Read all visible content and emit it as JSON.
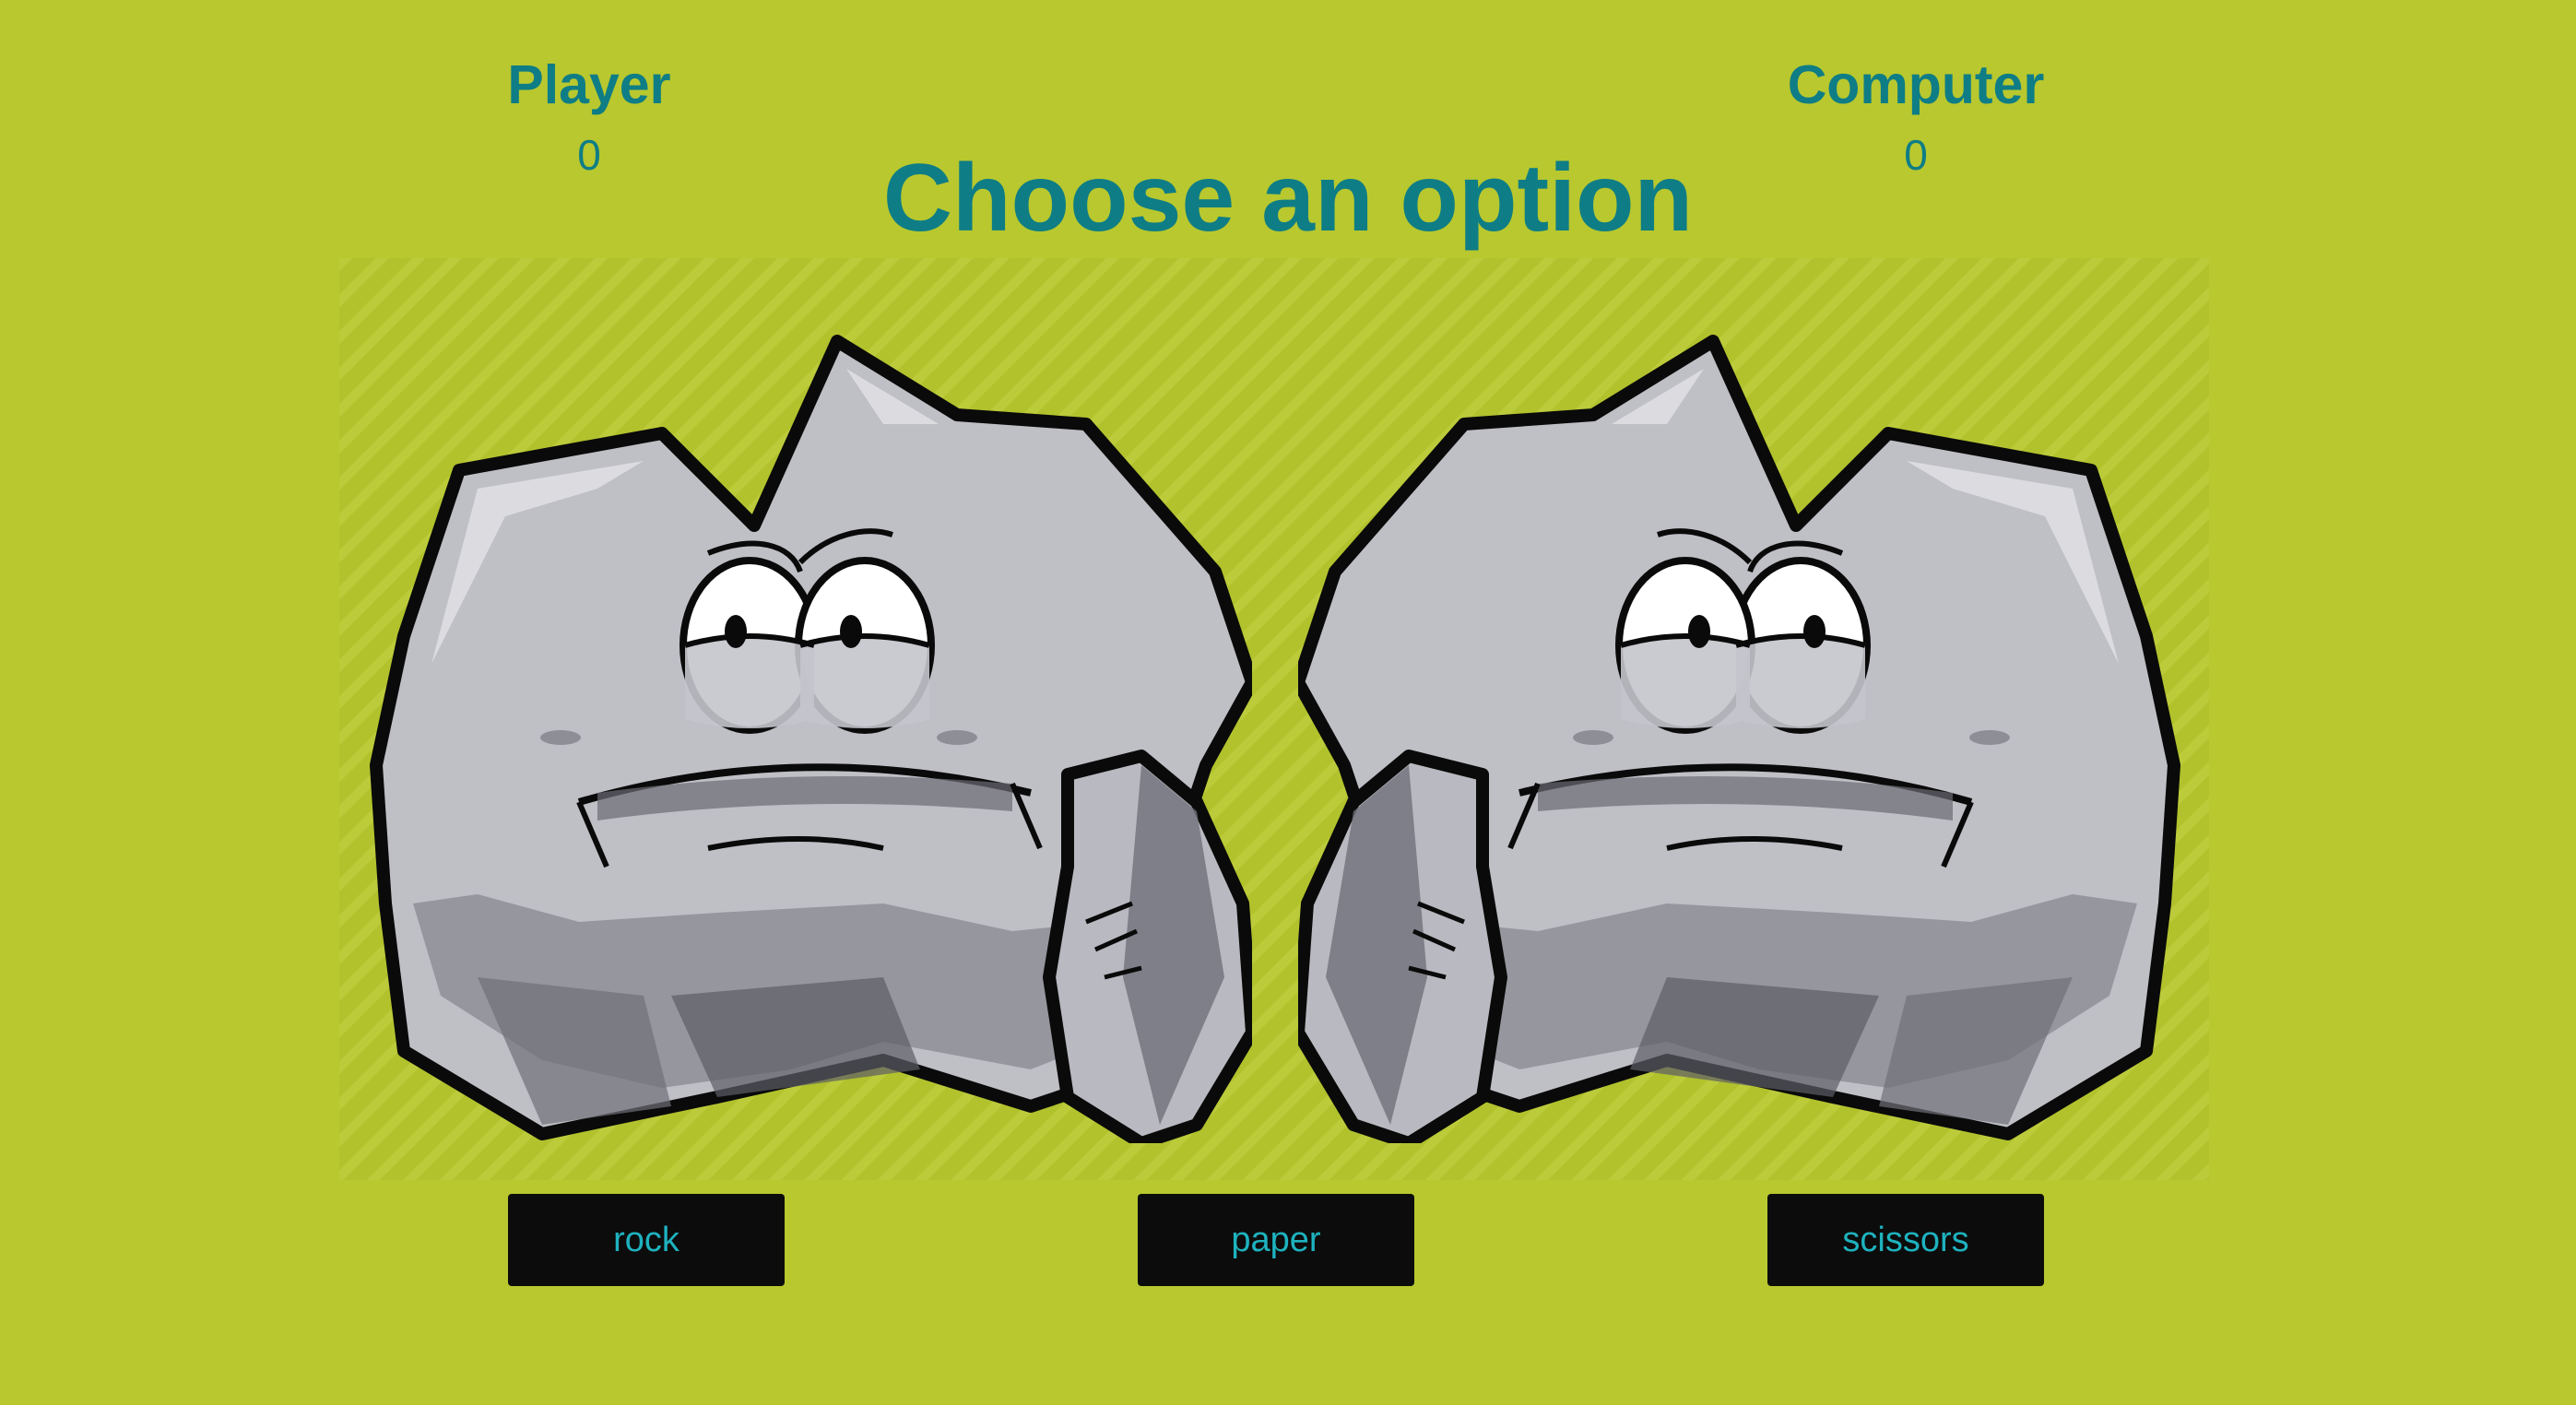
{
  "scoreboard": {
    "player_label": "Player",
    "player_score": "0",
    "computer_label": "Computer",
    "computer_score": "0"
  },
  "title": "Choose an option",
  "hands": {
    "player": "rock-icon",
    "computer": "rock-icon"
  },
  "buttons": {
    "rock": "rock",
    "paper": "paper",
    "scissors": "scissors"
  },
  "colors": {
    "background": "#b8c82e",
    "accent_text": "#0e7d86",
    "button_bg": "#0c0c0c",
    "button_text": "#1eb2bf"
  }
}
